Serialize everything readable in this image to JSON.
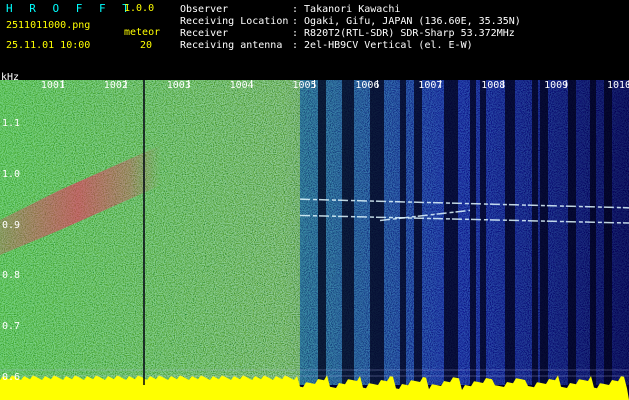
{
  "header": {
    "brand": "H R O F F T",
    "version": "1.0.0",
    "filename": "2511011000.png",
    "datetime": "25.11.01 10:00",
    "meteor_label": "meteor",
    "meteor_count": "20",
    "info": [
      {
        "label": "Observer",
        "value": ": Takanori Kawachi"
      },
      {
        "label": "Receiving Location",
        "value": ": Ogaki, Gifu, JAPAN (136.60E, 35.35N)"
      },
      {
        "label": "Receiver",
        "value": ": R820T2(RTL-SDR) SDR-Sharp 53.372MHz"
      },
      {
        "label": "Receiving antenna",
        "value": ": 2el-HB9CV Vertical (el. E-W)"
      }
    ]
  },
  "chart_data": {
    "type": "heatmap",
    "ylabel": "kHz",
    "yticks": [
      "1.1",
      "1.0",
      "0.9",
      "0.8",
      "0.7",
      "0.6"
    ],
    "xticks": [
      "1001",
      "1002",
      "1003",
      "1004",
      "1005",
      "1006",
      "1007",
      "1008",
      "1009",
      "1010"
    ],
    "ylim": [
      0.58,
      1.17
    ],
    "xlim": [
      1000,
      1010
    ]
  },
  "colors": {
    "label_text": "#ffffff",
    "brand_text": "#00ffff",
    "meta_text": "#ffff00",
    "noise_floor": "#ffff00",
    "trace": "#e0f8ff"
  }
}
